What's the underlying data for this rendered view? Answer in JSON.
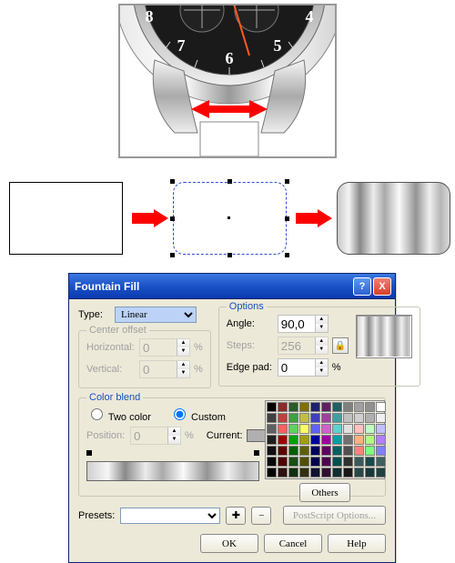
{
  "dialog": {
    "title": "Fountain Fill",
    "type_label": "Type:",
    "type_value": "Linear",
    "center_offset": {
      "legend": "Center offset",
      "horizontal_label": "Horizontal:",
      "horizontal_value": "0",
      "vertical_label": "Vertical:",
      "vertical_value": "0",
      "unit": "%"
    },
    "options": {
      "legend": "Options",
      "angle_label": "Angle:",
      "angle_value": "90,0",
      "steps_label": "Steps:",
      "steps_value": "256",
      "edgepad_label": "Edge pad:",
      "edgepad_value": "0",
      "unit": "%"
    },
    "color_blend": {
      "legend": "Color blend",
      "two_color_label": "Two color",
      "custom_label": "Custom",
      "position_label": "Position:",
      "position_value": "0",
      "position_unit": "%",
      "current_label": "Current:",
      "others_label": "Others"
    },
    "presets": {
      "label": "Presets:",
      "value": ""
    },
    "postscript_label": "PostScript Options...",
    "buttons": {
      "ok": "OK",
      "cancel": "Cancel",
      "help": "Help"
    },
    "swatches": [
      "#000000",
      "#8b2b2b",
      "#2b5a2b",
      "#807000",
      "#202070",
      "#602060",
      "#206060",
      "#808080",
      "#a0a0a0",
      "#909090",
      "#ffffff",
      "#404040",
      "#c04040",
      "#40a040",
      "#c0c040",
      "#4040c0",
      "#a040a0",
      "#40a0a0",
      "#c0c0c0",
      "#d0d0d0",
      "#b0b0b0",
      "#f0f0f0",
      "#606060",
      "#ff6060",
      "#60d060",
      "#ffff60",
      "#6060ff",
      "#d060d0",
      "#60d0d0",
      "#e0e0e0",
      "#ffc0c0",
      "#c0ffc0",
      "#c0c0ff",
      "#202020",
      "#a00000",
      "#00a000",
      "#a0a000",
      "#0000a0",
      "#a000a0",
      "#00a0a0",
      "#707070",
      "#ffb080",
      "#b0ff80",
      "#b080ff",
      "#101010",
      "#600000",
      "#006000",
      "#606000",
      "#000060",
      "#600060",
      "#006060",
      "#505050",
      "#ff8080",
      "#80ff80",
      "#8080ff",
      "#080808",
      "#500000",
      "#174f17",
      "#505000",
      "#000050",
      "#500050",
      "#005050",
      "#303030",
      "#3a5a5a",
      "#1a4a4a",
      "#406060",
      "#000000",
      "#301010",
      "#103010",
      "#303010",
      "#101030",
      "#301030",
      "#103030",
      "#181818",
      "#284848",
      "#183838",
      "#204040"
    ]
  }
}
